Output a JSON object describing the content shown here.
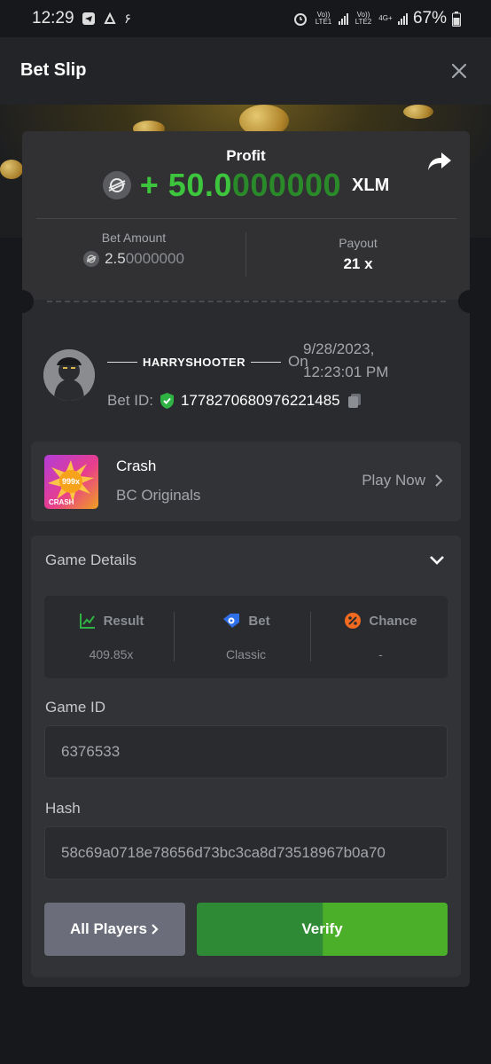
{
  "status_bar": {
    "time": "12:29",
    "extra_glyph": "۶",
    "net1": "Vo)) LTE1",
    "net2": "Vo)) LTE2",
    "net3": "4G+",
    "battery": "67%"
  },
  "header": {
    "title": "Bet Slip"
  },
  "profit": {
    "label": "Profit",
    "sign": "+ ",
    "amount_main": "50.0",
    "amount_dim": "000000",
    "currency": "XLM"
  },
  "bet_amount": {
    "label": "Bet Amount",
    "value_main": "2.5",
    "value_dim": "0000000"
  },
  "payout": {
    "label": "Payout",
    "value": "21 x"
  },
  "user": {
    "name": "HARRYSHOOTER",
    "on": "On",
    "date": "9/28/2023,",
    "time": "12:23:01 PM",
    "bet_id_label": "Bet ID:",
    "bet_id": "1778270680976221485"
  },
  "game": {
    "name": "Crash",
    "provider": "BC Originals",
    "play_label": "Play Now",
    "thumb_text": "999x",
    "thumb_label": "CRASH"
  },
  "details": {
    "title": "Game Details",
    "result": {
      "label": "Result",
      "value": "409.85x"
    },
    "bet": {
      "label": "Bet",
      "value": "Classic"
    },
    "chance": {
      "label": "Chance",
      "value": "-"
    },
    "game_id_label": "Game ID",
    "game_id": "6376533",
    "hash_label": "Hash",
    "hash": "58c69a0718e78656d73bc3ca8d73518967b0a70",
    "all_players": "All Players",
    "verify": "Verify"
  },
  "colors": {
    "profit_green": "#3dc63d",
    "verify_green": "#4caf2a",
    "background": "#17181b"
  }
}
